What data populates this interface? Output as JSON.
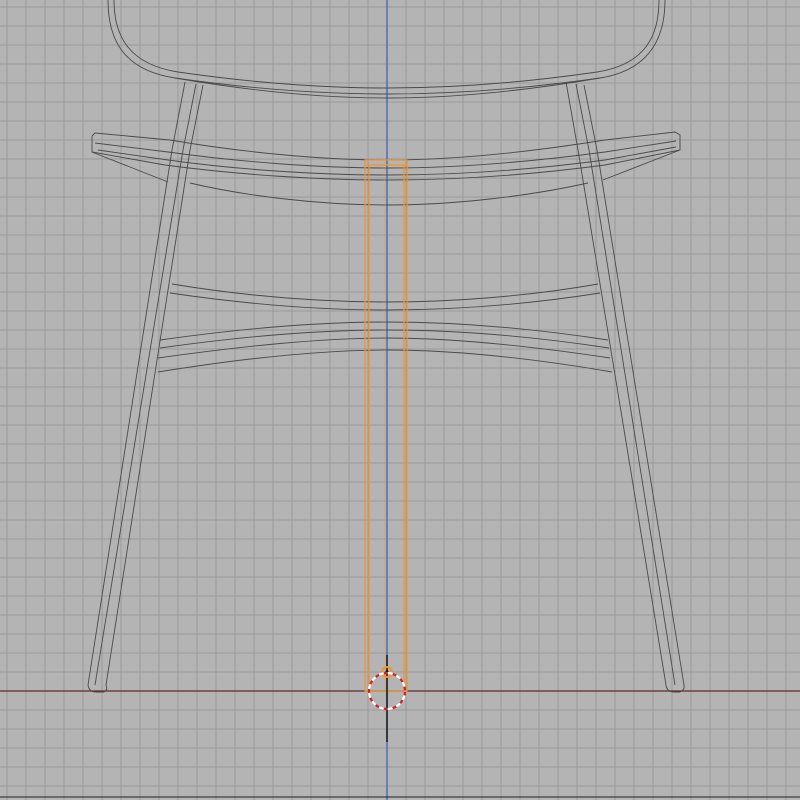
{
  "viewport": {
    "view": "front-orthographic-wireframe",
    "background_color": "#b4b4b4",
    "grid_color": "#9a9a9a",
    "z_axis_color": "#4a6fb5",
    "x_axis_color": "#5a2a2a",
    "wire_color": "#4a4a4a",
    "selection_color": "#f5922b",
    "cursor_colors": [
      "#d42020",
      "#ffffff"
    ]
  },
  "scene": {
    "objects": [
      {
        "name": "chair-backrest",
        "selected": false
      },
      {
        "name": "chair-armrest-rail",
        "selected": false
      },
      {
        "name": "chair-seat",
        "selected": false
      },
      {
        "name": "chair-leg-left",
        "selected": false
      },
      {
        "name": "chair-leg-right",
        "selected": false
      },
      {
        "name": "chair-stretchers",
        "selected": false
      },
      {
        "name": "selected-leg-box",
        "selected": true
      }
    ],
    "icons": [
      "3d-cursor-icon",
      "object-origin-icon"
    ]
  }
}
